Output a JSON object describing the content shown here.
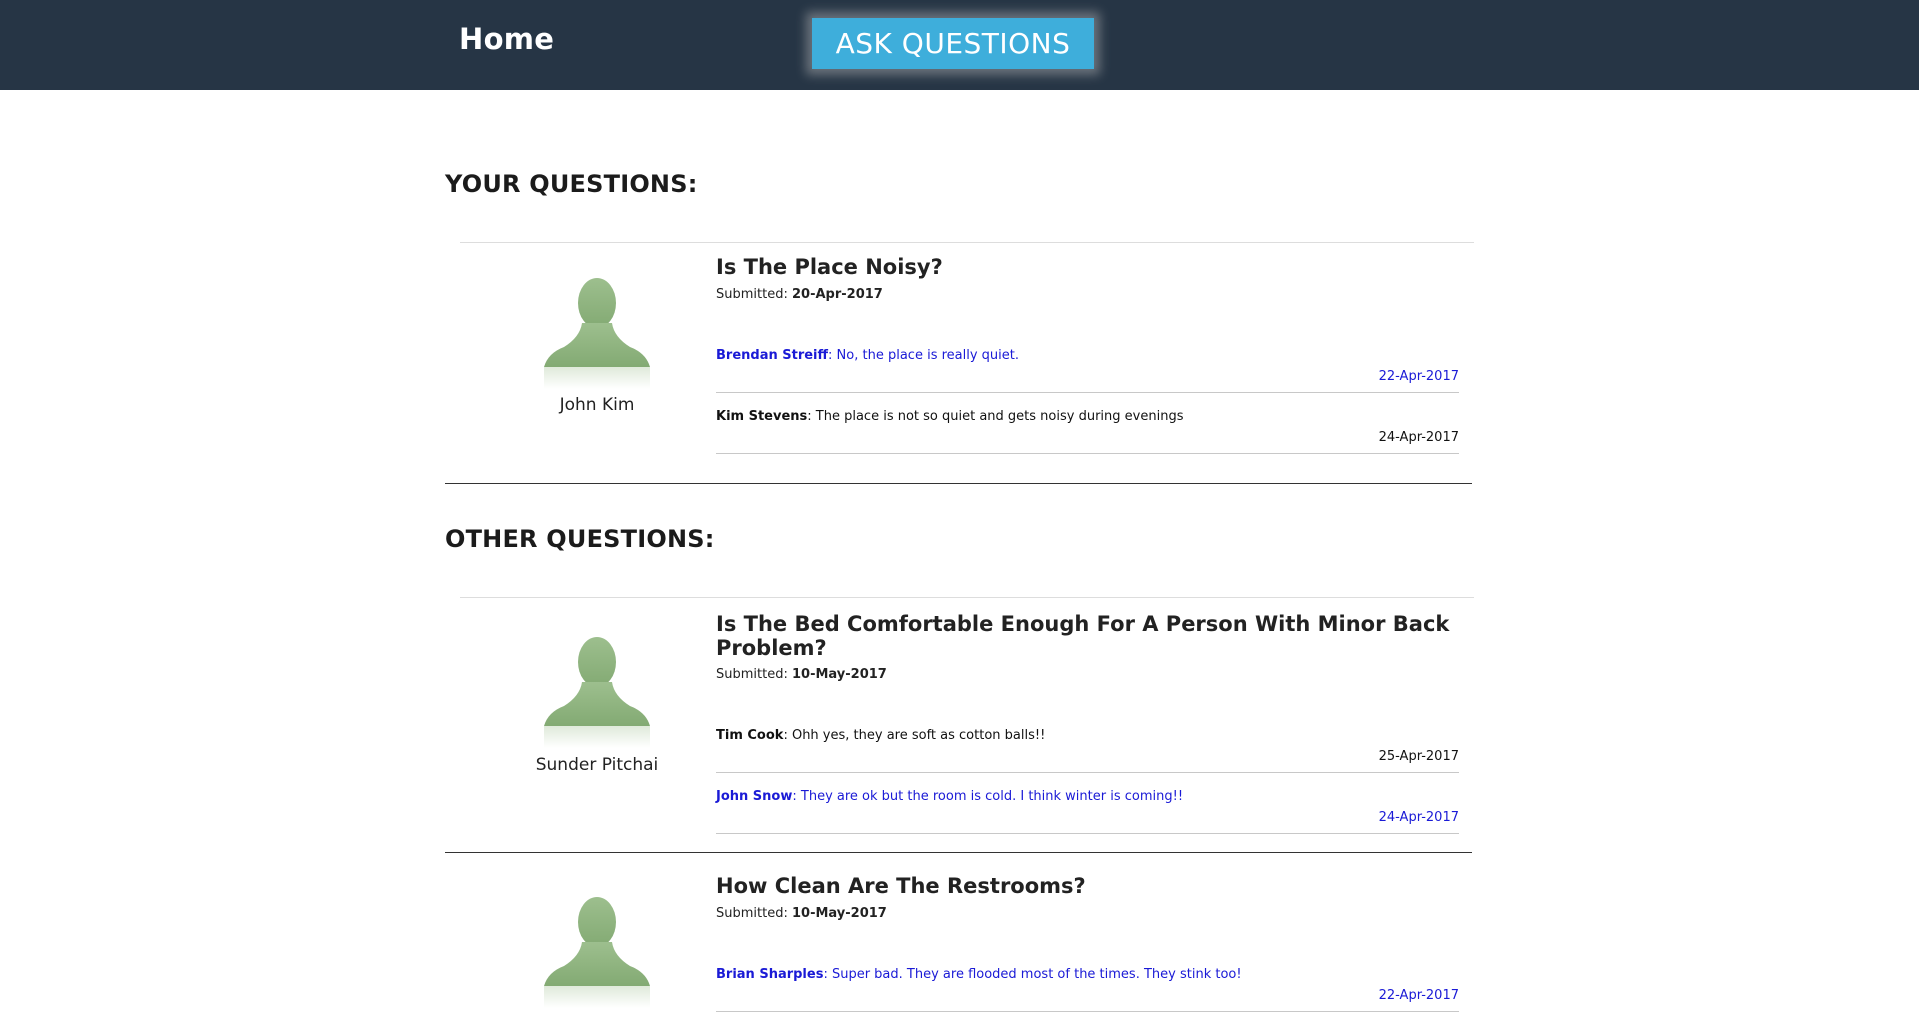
{
  "header": {
    "home_label": "Home",
    "ask_button_label": "ASK QUESTIONS",
    "background_color": "#263545",
    "button_color": "#3eaedb"
  },
  "your_questions": {
    "heading": "YOUR QUESTIONS:",
    "items": [
      {
        "asker": "John Kim",
        "title": "Is The Place Noisy?",
        "submitted_label": "Submitted:",
        "submitted_date": "20-Apr-2017",
        "answers": [
          {
            "author": "Brendan Streiff",
            "text": ": No, the place is really quiet.",
            "date": "22-Apr-2017",
            "color": "#1a1ad6"
          },
          {
            "author": "Kim Stevens",
            "text": ": The place is not so quiet and gets noisy during evenings",
            "date": "24-Apr-2017",
            "color": "#111111"
          }
        ]
      }
    ]
  },
  "other_questions": {
    "heading": "OTHER QUESTIONS:",
    "items": [
      {
        "asker": "Sunder Pitchai",
        "title": "Is The Bed Comfortable Enough For A Person With Minor Back Problem?",
        "submitted_label": "Submitted:",
        "submitted_date": "10-May-2017",
        "answers": [
          {
            "author": "Tim Cook",
            "text": ": Ohh yes, they are soft as cotton balls!!",
            "date": "25-Apr-2017",
            "color": "#111111"
          },
          {
            "author": "John Snow",
            "text": ": They are ok but the room is cold. I think winter is coming!!",
            "date": "24-Apr-2017",
            "color": "#1a1ad6"
          }
        ]
      },
      {
        "asker": "",
        "title": "How Clean Are The Restrooms?",
        "submitted_label": "Submitted:",
        "submitted_date": "10-May-2017",
        "answers": [
          {
            "author": "Brian Sharples",
            "text": ": Super bad. They are flooded most of the times. They stink too!",
            "date": "22-Apr-2017",
            "color": "#1a1ad6"
          }
        ]
      }
    ]
  },
  "icons": {
    "avatar": "user-silhouette-icon"
  }
}
